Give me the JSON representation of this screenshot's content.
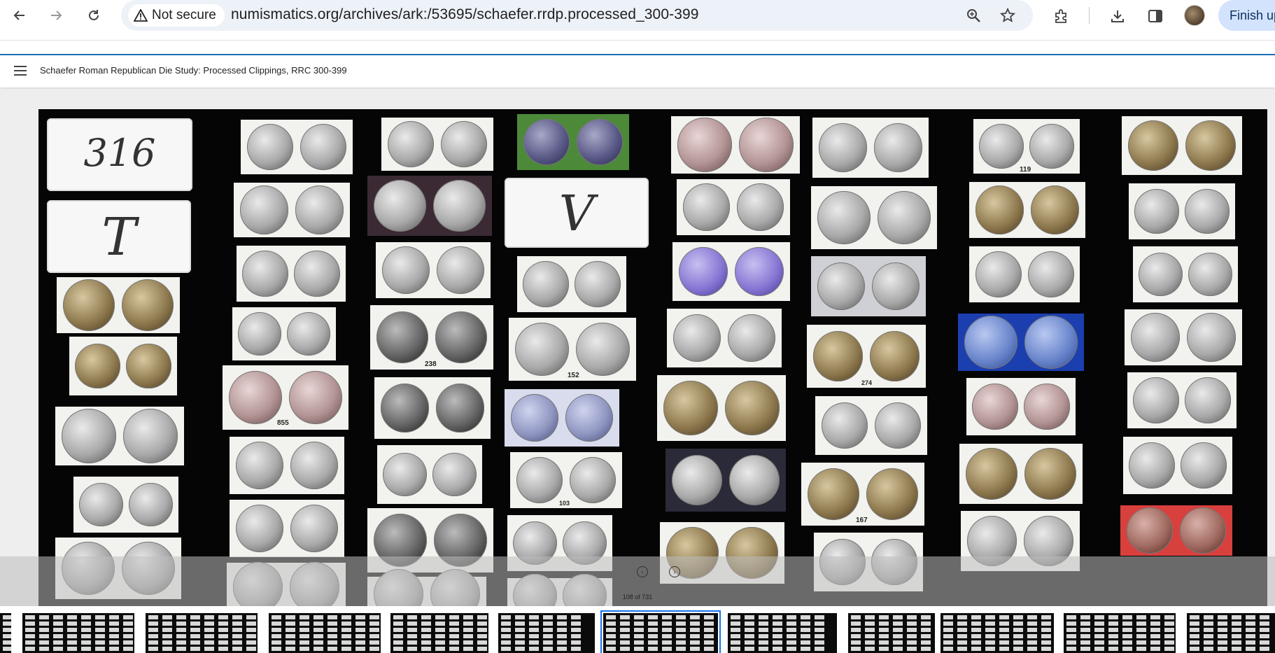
{
  "browser": {
    "security_label": "Not secure",
    "url": "numismatics.org/archives/ark:/53695/schaefer.rrdp.processed_300-399",
    "finish_label": "Finish up"
  },
  "viewer": {
    "title": "Schaefer Roman Republican Die Study: Processed Clippings, RRC 300-399",
    "page_counter": "108 of 731"
  },
  "scan": {
    "tag_numbers": [
      "316",
      "T",
      "V"
    ],
    "card_numbers": [
      "855",
      "238",
      "152",
      "103",
      "167",
      "119",
      "274"
    ]
  }
}
